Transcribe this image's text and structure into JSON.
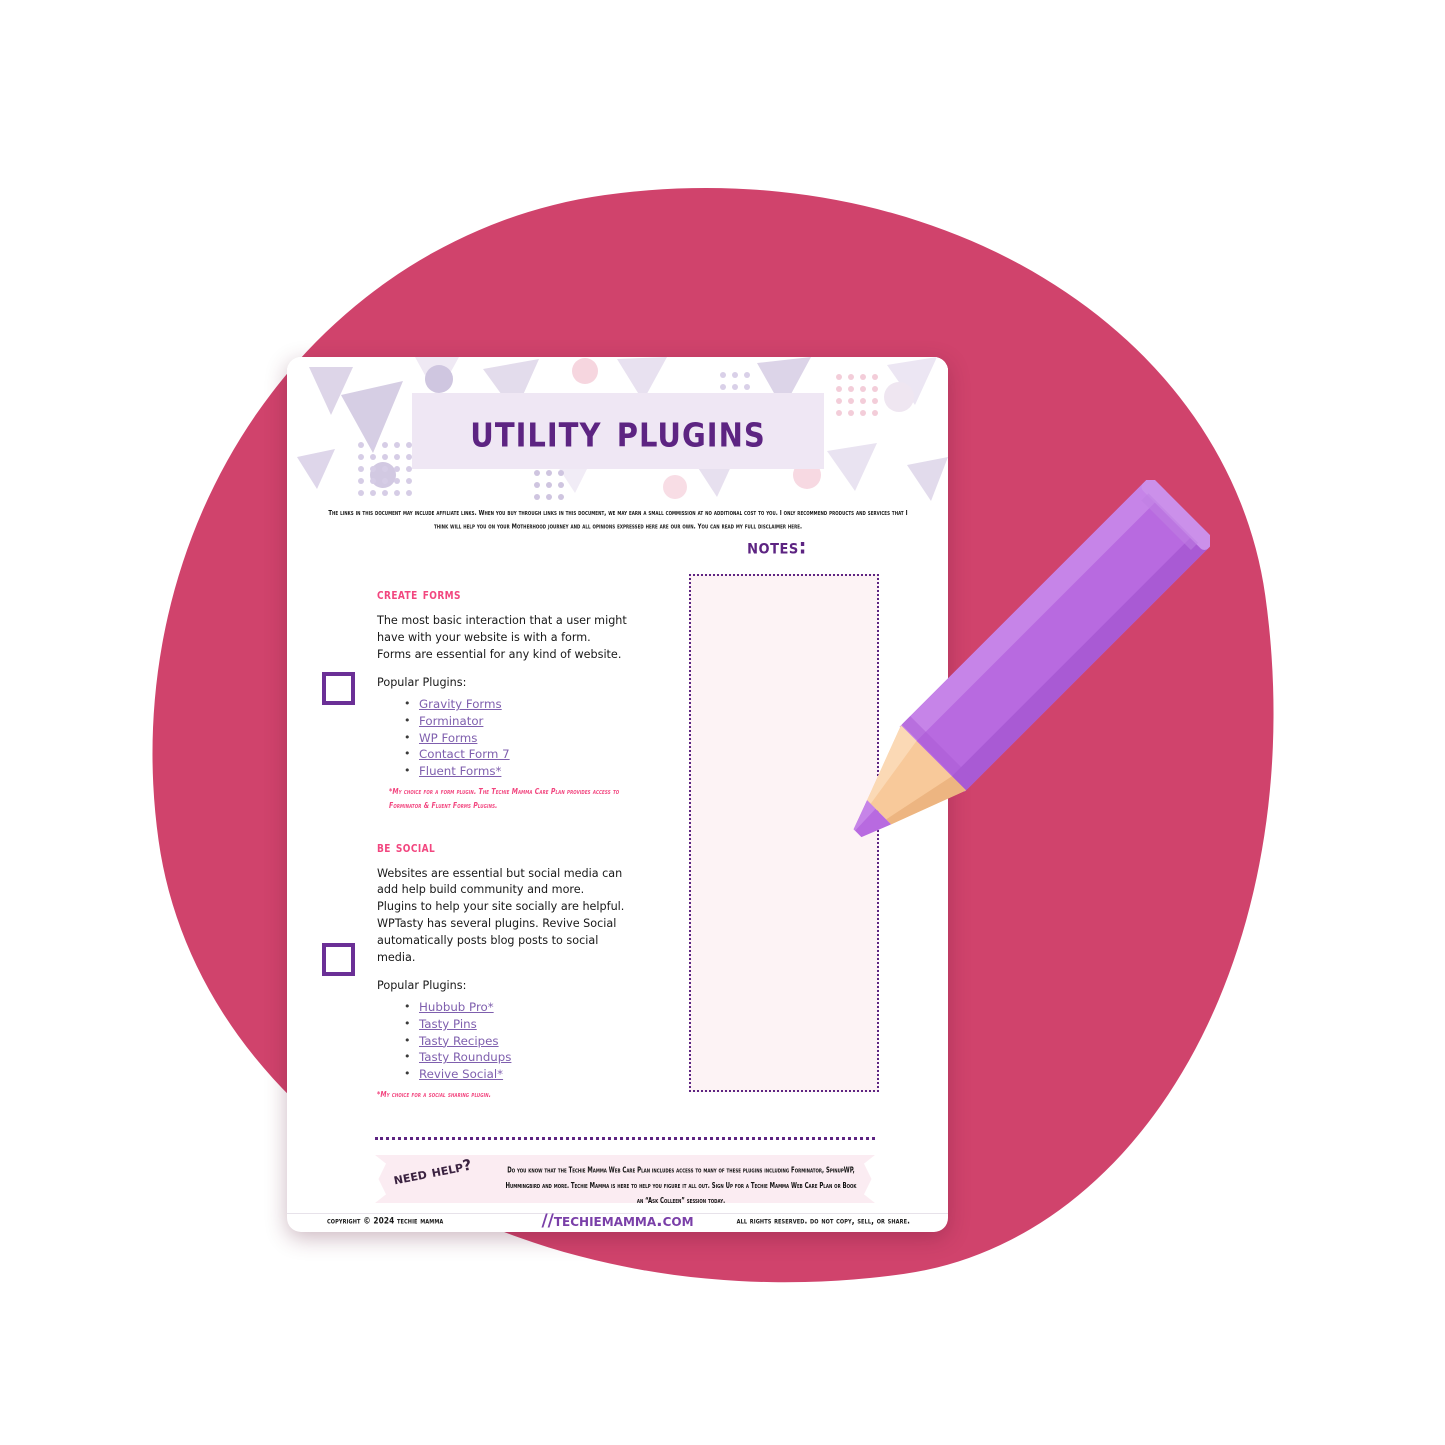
{
  "document": {
    "title": "Utility Plugins",
    "disclaimer": "The links in this document may include affiliate links. When you buy through links in this document, we may earn a small commission at no additional cost to you. I only recommend products and services that I think will help you on your Motherhood journey and all opinions expressed here are our own. You can read my full disclaimer here.",
    "notes_label": "Notes:"
  },
  "sections": [
    {
      "heading": "Create Forms",
      "body": "The most basic interaction that a user might have with your website is with a form. Forms are essential for any kind of website.",
      "plugins_label": "Popular Plugins:",
      "plugins": [
        "Gravity Forms",
        "Forminator",
        "WP Forms",
        "Contact Form 7",
        "Fluent Forms*"
      ],
      "footnote": "*My choice for a form plugin. The Techie Mamma Care Plan provides access to Forminator & Fluent Forms Plugins."
    },
    {
      "heading": "Be Social",
      "body": "Websites are essential but social media can add help build community and more. Plugins to help your site socially are helpful. WPTasty has several plugins. Revive Social automatically posts blog posts to social media.",
      "plugins_label": "Popular Plugins:",
      "plugins": [
        "Hubbub Pro*",
        "Tasty Pins",
        "Tasty Recipes",
        "Tasty Roundups",
        "Revive Social*"
      ],
      "footnote": "*My choice for a social sharing plugin."
    }
  ],
  "help": {
    "badge": "Need Help?",
    "text": "Do you know that the Techie Mamma Web Care Plan includes access to many of these plugins including Forminator, SpinupWP, Hummingbird and more. Techie Mamma is here to help you figure it all out. Sign Up for a Techie Mamma Web Care Plan or Book an “Ask Colleen” session today."
  },
  "footer": {
    "copyright": "Copyright © 2024 Techie Mamma",
    "website": "//techiemamma.com",
    "rights": "All Rights Reserved. Do Not Copy, Sell, or Share."
  },
  "colors": {
    "blob": "#d0436c",
    "heading_pink": "#f2467f",
    "purple_dark": "#5d2482",
    "link_purple": "#7f5fae",
    "notes_fill": "#fdf3f5",
    "pencil_body": "#b86ae0",
    "pencil_wood": "#f8c99a"
  }
}
